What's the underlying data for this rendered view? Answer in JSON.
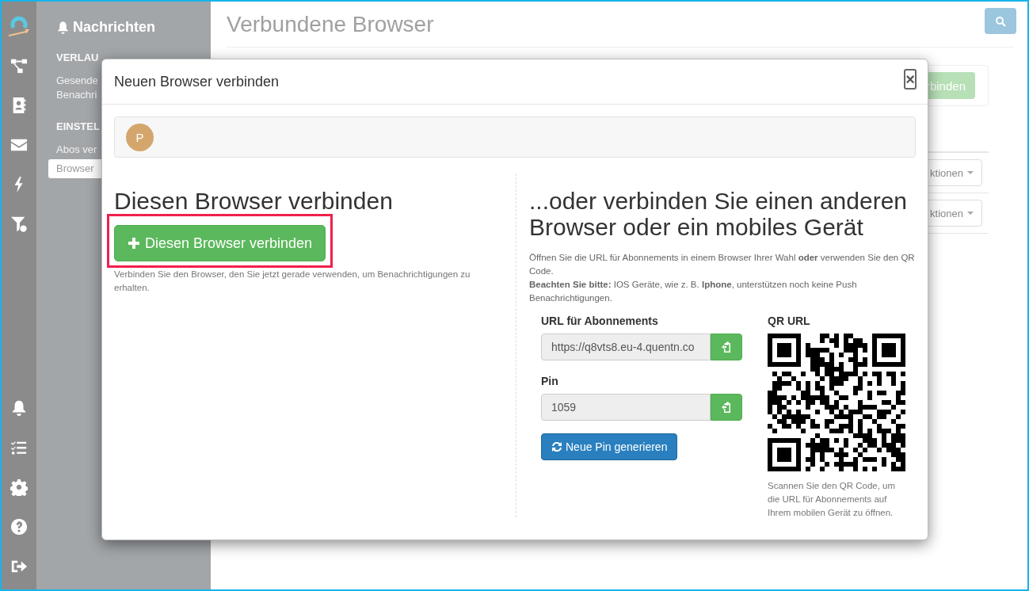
{
  "sidebar": {
    "title": "Nachrichten",
    "sections": [
      {
        "heading": "VERLAU",
        "items": [
          {
            "lines": [
              "Gesende",
              "Benachri"
            ],
            "selected": false
          }
        ]
      },
      {
        "heading": "EINSTEL",
        "items": [
          {
            "lines": [
              "Abos ver"
            ],
            "selected": false
          },
          {
            "lines": [
              "Browser"
            ],
            "selected": true
          }
        ]
      }
    ]
  },
  "page": {
    "title": "Verbundene Browser",
    "panel_button": "rbinden",
    "rows": [
      {
        "actions": "ktionen"
      },
      {
        "actions": "ktionen"
      }
    ]
  },
  "dialog": {
    "title": "Neuen Browser verbinden",
    "close": "×",
    "avatar": "P",
    "left": {
      "heading": "Diesen Browser verbinden",
      "button": "Diesen Browser verbinden",
      "help": "Verbinden Sie den Browser, den Sie jetzt gerade verwenden, um Benachrichtigungen zu erhalten."
    },
    "right": {
      "heading": "...oder verbinden Sie einen anderen Browser oder ein mobiles Gerät",
      "paragraphs": [
        "Öffnen Sie die URL für Abonnements in einem Browser Ihrer Wahl **oder** verwenden Sie den QR Code.",
        "**Beachten Sie bitte:** IOS Geräte, wie z. B. **Iphone**, unterstützen noch keine Push Benachrichtigungen."
      ],
      "url_label": "URL für Abonnements",
      "url_value": "https://q8vts8.eu-4.quentn.co",
      "pin_label": "Pin",
      "pin_value": "1059",
      "new_pin_button": "Neue Pin generieren",
      "qr_label": "QR URL",
      "qr_caption": "Scannen Sie den QR Code, um die URL für Abonnements auf Ihrem mobilen Gerät zu öffnen."
    }
  }
}
